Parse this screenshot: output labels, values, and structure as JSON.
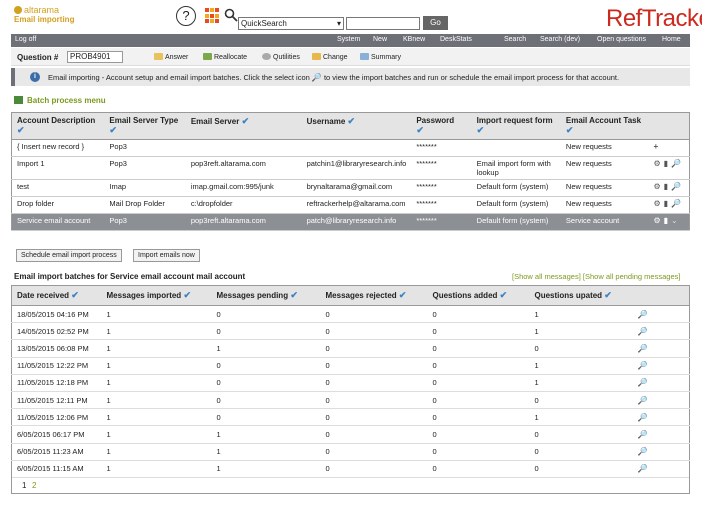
{
  "header": {
    "org": "altarama",
    "page_name": "Email importing",
    "help_label": "?",
    "search_select_value": "QuickSearch",
    "search_input_value": "",
    "go_label": "Go",
    "brand": "RefTracker"
  },
  "nav": {
    "logoff": "Log off",
    "items": [
      "System",
      "New",
      "KBnew",
      "DeskStats",
      "Search",
      "Search (dev)",
      "Open questions",
      "Home"
    ]
  },
  "question_bar": {
    "label": "Question #",
    "value": "PROB4901",
    "actions": [
      "Answer",
      "Reallocate",
      "Qutilities",
      "Change",
      "Summary"
    ]
  },
  "info": {
    "icon_label": "i",
    "message": "Email importing - Account setup and email import batches. Click the select icon",
    "message_after": "to view the import batches and run or schedule the email import process for that account.",
    "icon_mid": "search-icon"
  },
  "batch_menu": "Batch process menu",
  "accounts_table": {
    "headers": [
      "Account Description",
      "Email Server Type",
      "Email Server",
      "Username",
      "Password",
      "Import request form",
      "Email Account Task"
    ],
    "check_glyph": "✔",
    "rows": [
      {
        "desc": "{ Insert new record }",
        "type": "Pop3",
        "server": "",
        "username": "",
        "password": "*******",
        "form": "",
        "task": "New requests"
      },
      {
        "desc": "Import 1",
        "type": "Pop3",
        "server": "pop3reft.altarama.com",
        "username": "patchin1@libraryresearch.info",
        "password": "*******",
        "form": "Email import form with lookup",
        "task": "New requests"
      },
      {
        "desc": "test",
        "type": "Imap",
        "server": "imap.gmail.com:995/junk",
        "username": "brynaltarama@gmail.com",
        "password": "*******",
        "form": "Default form (system)",
        "task": "New requests"
      },
      {
        "desc": "Drop folder",
        "type": "Mail Drop Folder",
        "server": "c:\\dropfolder",
        "username": "reftrackerhelp@altarama.com",
        "password": "*******",
        "form": "Default form (system)",
        "task": "New requests"
      },
      {
        "desc": "Service email account",
        "type": "Pop3",
        "server": "pop3reft.altarama.com",
        "username": "patch@libraryresearch.info",
        "password": "*******",
        "form": "Default form (system)",
        "task": "Service account"
      }
    ]
  },
  "buttons": {
    "schedule": "Schedule email import process",
    "import_now": "Import emails now"
  },
  "batches": {
    "title": "Email import batches for Service email account mail account",
    "show_all": "[Show all messages]",
    "show_pending": "[Show all pending messages]",
    "headers": [
      "Date received",
      "Messages imported",
      "Messages pending",
      "Messages rejected",
      "Questions added",
      "Questions upated"
    ],
    "rows": [
      [
        "18/05/2015 04:16 PM",
        "1",
        "0",
        "0",
        "0",
        "1"
      ],
      [
        "14/05/2015 02:52 PM",
        "1",
        "0",
        "0",
        "0",
        "1"
      ],
      [
        "13/05/2015 06:08 PM",
        "1",
        "1",
        "0",
        "0",
        "0"
      ],
      [
        "11/05/2015 12:22 PM",
        "1",
        "0",
        "0",
        "0",
        "1"
      ],
      [
        "11/05/2015 12:18 PM",
        "1",
        "0",
        "0",
        "0",
        "1"
      ],
      [
        "11/05/2015 12:11 PM",
        "1",
        "0",
        "0",
        "0",
        "0"
      ],
      [
        "11/05/2015 12:06 PM",
        "1",
        "0",
        "0",
        "0",
        "1"
      ],
      [
        "6/05/2015 06:17 PM",
        "1",
        "1",
        "0",
        "0",
        "0"
      ],
      [
        "6/05/2015 11:23 AM",
        "1",
        "1",
        "0",
        "0",
        "0"
      ],
      [
        "6/05/2015 11:15 AM",
        "1",
        "1",
        "0",
        "0",
        "0"
      ]
    ]
  },
  "pager": {
    "pages": [
      "1",
      "2"
    ]
  },
  "colors": {
    "accent_green": "#7a9a1f",
    "brand_red": "#cc2a1e",
    "nav_gray": "#6d7076"
  }
}
